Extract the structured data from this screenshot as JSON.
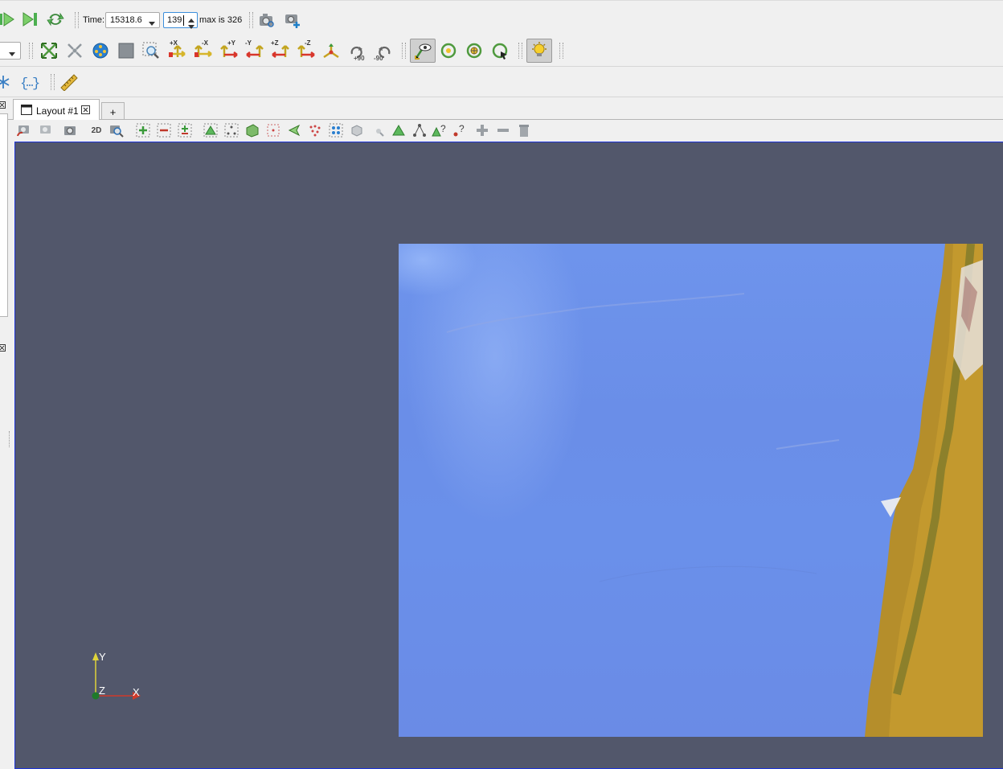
{
  "time_toolbar": {
    "time_label": "Time:",
    "time_value": "15318.6",
    "timestep_value": "139",
    "max_label": "max is 326"
  },
  "view_toolbar": {
    "chips": [
      "+X",
      "-X",
      "+Y",
      "-Y",
      "+Z",
      "-Z",
      "+90",
      "-90"
    ]
  },
  "layout_tabs": {
    "active_tab": "Layout #1",
    "add_tab": "+"
  },
  "render_toolbar": {
    "mode_2d": "2D"
  },
  "orientation_axes": {
    "x_label": "X",
    "y_label": "Y",
    "z_label": "Z"
  },
  "icons": {
    "play_next": "play-icon",
    "last_frame": "last-frame-icon",
    "loop": "loop-icon",
    "screenshot": "camera-icon",
    "ruler": "ruler-icon",
    "light": "lightbulb-icon"
  },
  "colors": {
    "view_background": "#52576b",
    "view_border": "#1d33d8",
    "ocean": "#6a8ee8",
    "land": "#b08a2a"
  }
}
